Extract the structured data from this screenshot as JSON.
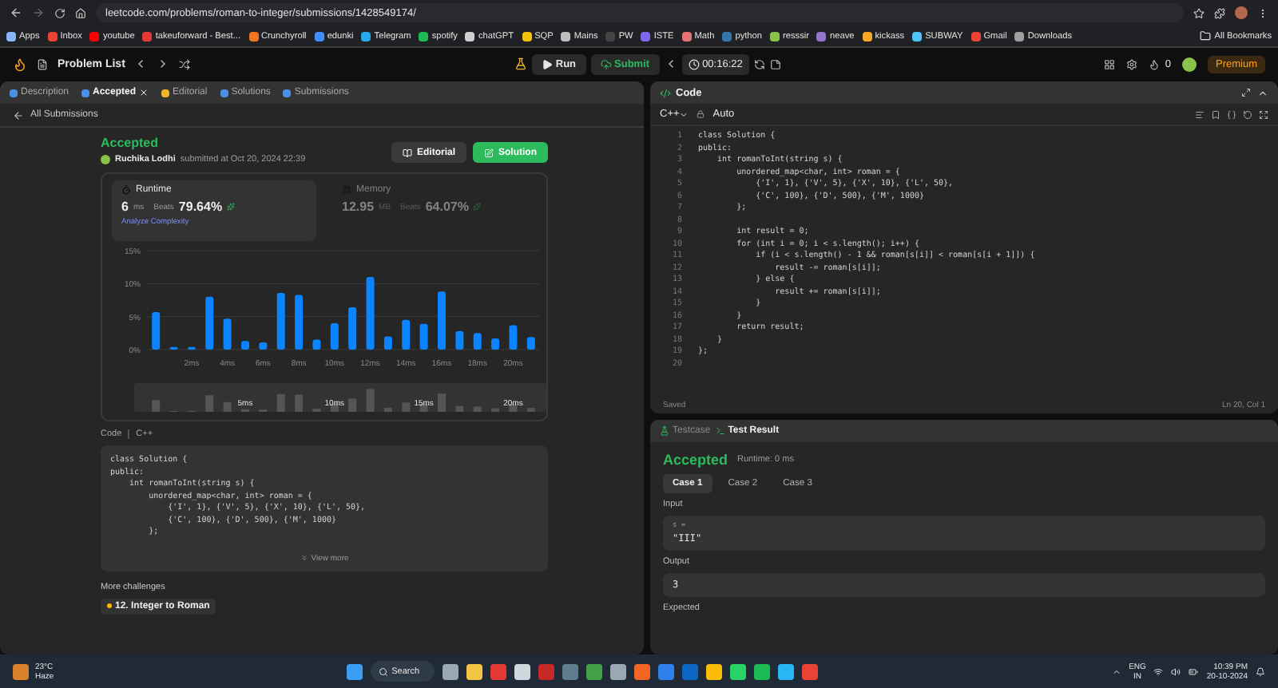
{
  "browser": {
    "url": "leetcode.com/problems/roman-to-integer/submissions/1428549174/"
  },
  "bookmarks": [
    {
      "label": "Apps",
      "color": "#8ab4f8"
    },
    {
      "label": "Inbox",
      "color": "#ea4335"
    },
    {
      "label": "youtube",
      "color": "#ff0000"
    },
    {
      "label": "takeuforward - Best...",
      "color": "#e53935"
    },
    {
      "label": "Crunchyroll",
      "color": "#f47521"
    },
    {
      "label": "edunki",
      "color": "#3f8efc"
    },
    {
      "label": "Telegram",
      "color": "#29a9eb"
    },
    {
      "label": "spotify",
      "color": "#1db954"
    },
    {
      "label": "chatGPT",
      "color": "#d0d0d0"
    },
    {
      "label": "SQP",
      "color": "#f4c20d"
    },
    {
      "label": "Mains",
      "color": "#bdbdbd"
    },
    {
      "label": "PW",
      "color": "#444444"
    },
    {
      "label": "ISTE",
      "color": "#7b68ee"
    },
    {
      "label": "Math",
      "color": "#e57373"
    },
    {
      "label": "python",
      "color": "#3776ab"
    },
    {
      "label": "resssir",
      "color": "#8bc34a"
    },
    {
      "label": "neave",
      "color": "#9575cd"
    },
    {
      "label": "kickass",
      "color": "#f9a825"
    },
    {
      "label": "SUBWAY",
      "color": "#4fc3f7"
    },
    {
      "label": "Gmail",
      "color": "#ea4335"
    },
    {
      "label": "Downloads",
      "color": "#9e9e9e"
    }
  ],
  "all_bookmarks": "All Bookmarks",
  "nav": {
    "problem_list": "Problem List",
    "run": "Run",
    "submit": "Submit",
    "timer": "00:16:22",
    "count": "0",
    "premium": "Premium"
  },
  "left": {
    "tabs": [
      {
        "label": "Description",
        "selected": false,
        "closable": false,
        "color": "#4a90e2"
      },
      {
        "label": "Accepted",
        "selected": true,
        "closable": true,
        "color": "#4a90e2"
      },
      {
        "label": "Editorial",
        "selected": false,
        "closable": false,
        "color": "#f0b429"
      },
      {
        "label": "Solutions",
        "selected": false,
        "closable": false,
        "color": "#4a90e2"
      },
      {
        "label": "Submissions",
        "selected": false,
        "closable": false,
        "color": "#4a90e2"
      }
    ],
    "back": "All Submissions",
    "status": "Accepted",
    "author": "Ruchika Lodhi",
    "submitted": "submitted at Oct 20, 2024 22:39",
    "buttons": [
      {
        "label": "Editorial",
        "kind": "secondary"
      },
      {
        "label": "Solution",
        "kind": "primary"
      }
    ],
    "metrics": [
      {
        "title": "Runtime",
        "value": "6",
        "unit": "ms",
        "beats_label": "Beats",
        "beats": "79.64%",
        "selected": true
      },
      {
        "title": "Memory",
        "value": "12.95",
        "unit": "MB",
        "beats_label": "Beats",
        "beats": "64.07%",
        "selected": false
      }
    ],
    "analyze": "Analyze Complexity",
    "chart_data": {
      "type": "bar",
      "x": [
        0,
        1,
        2,
        3,
        4,
        5,
        6,
        7,
        8,
        9,
        10,
        11,
        12,
        13,
        14,
        15,
        16,
        17,
        18,
        19,
        20,
        21
      ],
      "xlim": [
        -0.5,
        21.5
      ],
      "series": [
        {
          "color": "#0a84ff",
          "values": [
            5.7,
            0.4,
            0.4,
            8.0,
            4.7,
            1.3,
            1.1,
            8.6,
            8.3,
            1.5,
            4.0,
            6.4,
            11.0,
            2.0,
            4.5,
            3.9,
            8.8,
            2.8,
            2.5,
            1.7,
            3.7,
            1.9
          ]
        }
      ],
      "ylim": [
        0,
        15
      ],
      "yticks": [
        {
          "value": 0,
          "label": "0%"
        },
        {
          "value": 5,
          "label": "5%"
        },
        {
          "value": 10,
          "label": "10%"
        },
        {
          "value": 15,
          "label": "15%"
        }
      ],
      "xticks": [
        {
          "value": 2,
          "label": "2ms"
        },
        {
          "value": 4,
          "label": "4ms"
        },
        {
          "value": 6,
          "label": "6ms"
        },
        {
          "value": 8,
          "label": "8ms"
        },
        {
          "value": 10,
          "label": "10ms"
        },
        {
          "value": 12,
          "label": "12ms"
        },
        {
          "value": 14,
          "label": "14ms"
        },
        {
          "value": 16,
          "label": "16ms"
        },
        {
          "value": 18,
          "label": "18ms"
        },
        {
          "value": 20,
          "label": "20ms"
        }
      ]
    },
    "overview_labels": [
      "5ms",
      "10ms",
      "15ms",
      "20ms"
    ],
    "code_label": "Code",
    "language": "C++",
    "code": "class Solution {\npublic:\n    int romanToInt(string s) {\n        unordered_map<char, int> roman = {\n            {'I', 1}, {'V', 5}, {'X', 10}, {'L', 50},\n            {'C', 100}, {'D', 500}, {'M', 1000}\n        };",
    "view_more": "View more",
    "more_challenges": "More challenges",
    "challenges": [
      "12. Integer to Roman"
    ]
  },
  "editor": {
    "title": "Code",
    "language": "C++",
    "mode": "Auto",
    "line_numbers": [
      "1",
      "2",
      "3",
      "4",
      "5",
      "6",
      "7",
      "8",
      "9",
      "10",
      "11",
      "12",
      "13",
      "14",
      "15",
      "16",
      "17",
      "18",
      "19",
      "20"
    ],
    "code": "class Solution {\npublic:\n    int romanToInt(string s) {\n        unordered_map<char, int> roman = {\n            {'I', 1}, {'V', 5}, {'X', 10}, {'L', 50},\n            {'C', 100}, {'D', 500}, {'M', 1000}\n        };\n\n        int result = 0;\n        for (int i = 0; i < s.length(); i++) {\n            if (i < s.length() - 1 && roman[s[i]] < roman[s[i + 1]]) {\n                result -= roman[s[i]];\n            } else {\n                result += roman[s[i]];\n            }\n        }\n        return result;\n    }\n};\n",
    "status": "Saved",
    "position": "Ln 20, Col 1"
  },
  "tests": {
    "tabs": [
      {
        "label": "Testcase",
        "selected": false
      },
      {
        "label": "Test Result",
        "selected": true
      }
    ],
    "status": "Accepted",
    "runtime": "Runtime: 0 ms",
    "cases": [
      {
        "label": "Case 1",
        "selected": true
      },
      {
        "label": "Case 2",
        "selected": false
      },
      {
        "label": "Case 3",
        "selected": false
      }
    ],
    "input_label": "Input",
    "input_name": "s =",
    "input_value": "\"III\"",
    "output_label": "Output",
    "output_value": "3",
    "expected_label": "Expected"
  },
  "taskbar": {
    "temp": "23°C",
    "weather": "Haze",
    "search": "Search",
    "lang": "ENG",
    "region": "IN",
    "time": "10:39 PM",
    "date": "20-10-2024"
  }
}
